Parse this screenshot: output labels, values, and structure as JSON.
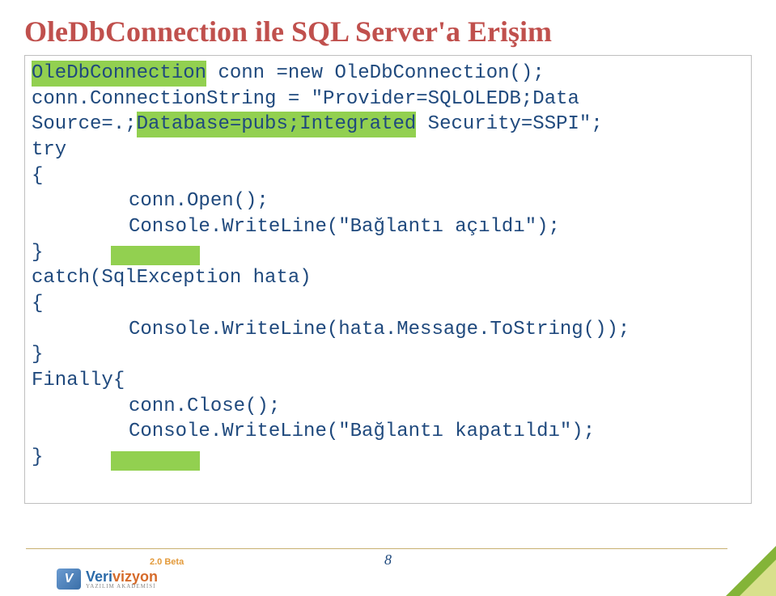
{
  "title": "OleDbConnection ile SQL Server'a Erişim",
  "code": {
    "l1a": "OleDbConnection",
    "l1b": " conn =new OleDbConnection();",
    "l2a": "conn.ConnectionString = \"Provider=SQLOLEDB;Data ",
    "l2b": "Source=.;",
    "l2c": "Database=pubs;Integrated",
    "l2d": " Security=SSPI\";",
    "l3": "try",
    "l4": "{",
    "l5": "conn.Open();",
    "l6a": "Console",
    "l6b": ".WriteLine(\"Bağlantı açıldı\");",
    "l7": "}",
    "l8": "catch(SqlException hata)",
    "l9": "{",
    "l10": "Console.WriteLine(hata.Message.ToString());",
    "l11": "}",
    "l12": "Finally{",
    "l13": "conn.Close();",
    "l14a": "Console",
    "l14b": ".WriteLine(\"Bağlantı kapatıldı\");",
    "l15": "}"
  },
  "page_number": "8",
  "logo": {
    "icon_letter": "V",
    "name_part1": "Veri",
    "name_part2": "vizyon",
    "tagline": "YAZILIM AKADEMİSİ",
    "beta": "2.0 Beta"
  }
}
